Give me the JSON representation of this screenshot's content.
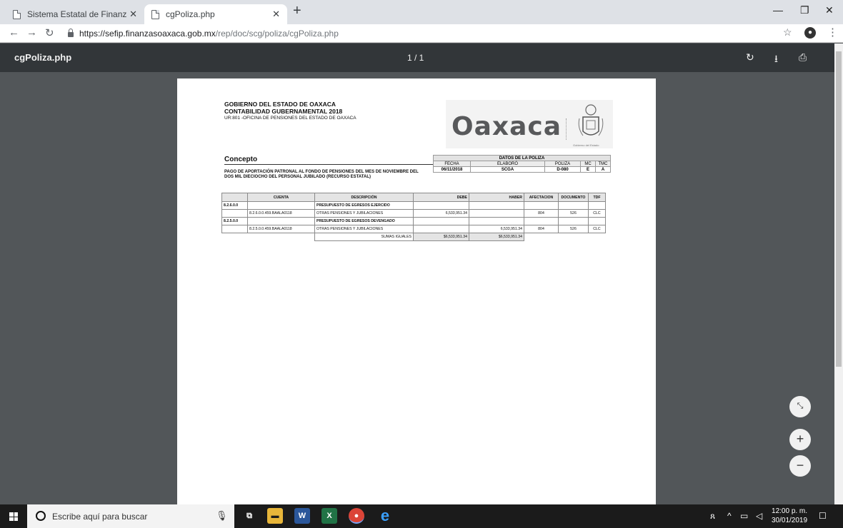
{
  "browser": {
    "tabs": [
      {
        "label": "Sistema Estatal de Finanzas Públic",
        "active": false
      },
      {
        "label": "cgPoliza.php",
        "active": true
      }
    ],
    "url_host": "https://sefip.finanzasoaxaca.gob.mx",
    "url_path": "/rep/doc/scg/poliza/cgPoliza.php"
  },
  "viewer": {
    "title": "cgPoliza.php",
    "pages": "1 / 1"
  },
  "document": {
    "header_line1": "GOBIERNO DEL ESTADO DE OAXACA",
    "header_line2": "CONTABILIDAD GUBERNAMENTAL 2018",
    "header_line3": "UR:801 -OFICINA DE PENSIONES DEL ESTADO DE OAXACA",
    "logo_word": "Oaxaca",
    "logo_caption": "Gobierno del Estado",
    "concepto_heading": "Concepto",
    "concepto_text": "PAGO DE APORTACIÓN PATRONAL AL FONDO DE PENSIONES DEL MES DE NOVIEMBRE DEL DOS MIL DIECIOCHO DEL PERSONAL JUBILADO (RECURSO ESTATAL)",
    "datos": {
      "title": "DATOS DE LA POLIZA",
      "labels": {
        "fecha": "FECHA",
        "elaboro": "ELABORÓ",
        "poliza": "POLIZA",
        "mc": "MC",
        "tmc": "TMC"
      },
      "values": {
        "fecha": "06/11/2018",
        "elaboro": "SCGA",
        "poliza": "D-080",
        "mc": "E",
        "tmc": "A"
      }
    },
    "table": {
      "headers": [
        "CUENTA",
        "DESCRIPCIÓN",
        "DEBE",
        "HABER",
        "AFECTACION",
        "DOCUMENTO",
        "TDF"
      ],
      "rows": [
        {
          "group": "8.2.6.0.0",
          "cuenta": "",
          "descripcion": "PRESUPUESTO DE EGRESOS EJERCIDO",
          "debe": "",
          "haber": "",
          "afectacion": "",
          "documento": "",
          "tdf": ""
        },
        {
          "group": "",
          "cuenta": "8.2.6.0.0.459.BAALA0118",
          "descripcion": "OTRAS PENSIONES Y JUBILACIONES",
          "debe": "6,533,951.34",
          "haber": "",
          "afectacion": "804",
          "documento": "526",
          "tdf": "CLC"
        },
        {
          "group": "8.2.5.0.0",
          "cuenta": "",
          "descripcion": "PRESUPUESTO DE EGRESOS DEVENGADO",
          "debe": "",
          "haber": "",
          "afectacion": "",
          "documento": "",
          "tdf": ""
        },
        {
          "group": "",
          "cuenta": "8.2.5.0.0.459.BAALA0118",
          "descripcion": "OTRAS PENSIONES Y JUBILACIONES",
          "debe": "",
          "haber": "6,533,951.34",
          "afectacion": "804",
          "documento": "526",
          "tdf": "CLC"
        }
      ],
      "sumas_label": "SUMAS IGUALES",
      "sumas_debe": "$6,533,951.34",
      "sumas_haber": "$6,533,951.34"
    }
  },
  "taskbar": {
    "search_placeholder": "Escribe aquí para buscar",
    "time": "12:00 p. m.",
    "date": "30/01/2019"
  }
}
